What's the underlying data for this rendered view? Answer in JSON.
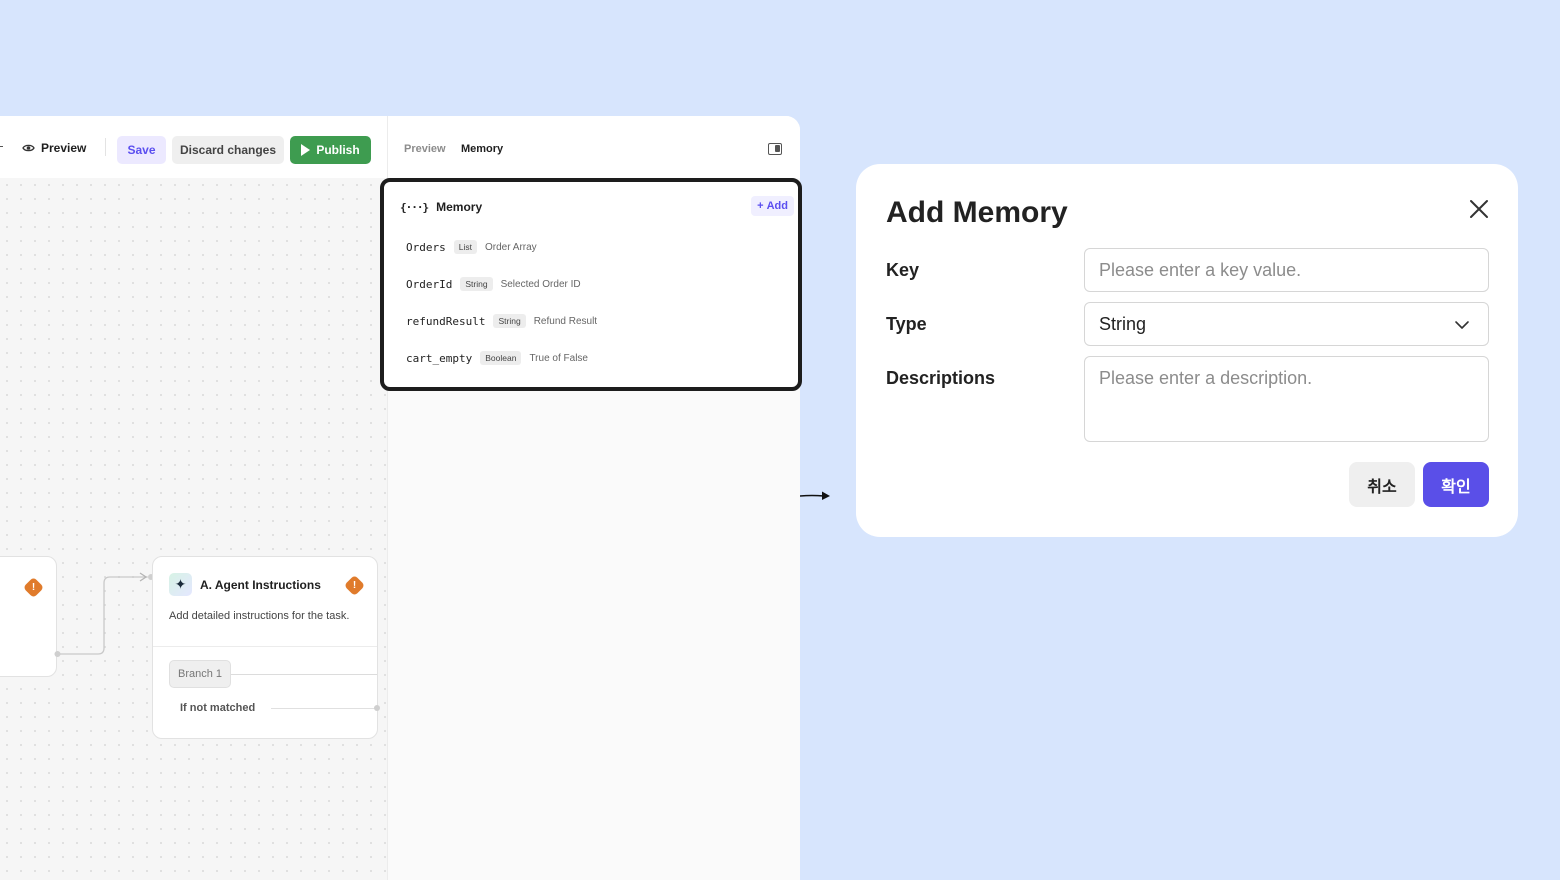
{
  "toolbar": {
    "preview_label": "Preview",
    "save_label": "Save",
    "discard_label": "Discard changes",
    "publish_label": "Publish"
  },
  "panel": {
    "tabs": [
      {
        "label": "Preview",
        "active": false
      },
      {
        "label": "Memory",
        "active": true
      }
    ]
  },
  "memory": {
    "title": "Memory",
    "add_label": "Add",
    "items": [
      {
        "key": "Orders",
        "type": "List",
        "description": "Order Array"
      },
      {
        "key": "OrderId",
        "type": "String",
        "description": "Selected Order ID"
      },
      {
        "key": "refundResult",
        "type": "String",
        "description": "Refund Result"
      },
      {
        "key": "cart_empty",
        "type": "Boolean",
        "description": "True of False"
      }
    ]
  },
  "flow": {
    "agent_node": {
      "title": "A. Agent Instructions",
      "description": "Add detailed instructions for the task.",
      "branch_label": "Branch 1",
      "fallback_label": "If not matched"
    },
    "warning_icon": "!"
  },
  "modal": {
    "title": "Add Memory",
    "key_label": "Key",
    "key_placeholder": "Please enter a key value.",
    "key_value": "",
    "type_label": "Type",
    "type_value": "String",
    "description_label": "Descriptions",
    "description_placeholder": "Please enter a description.",
    "cancel_label": "취소",
    "confirm_label": "확인"
  },
  "colors": {
    "background": "#d7e5fd",
    "accent": "#5a4fe8",
    "publish": "#3e9c50",
    "warning": "#e07b2b"
  }
}
